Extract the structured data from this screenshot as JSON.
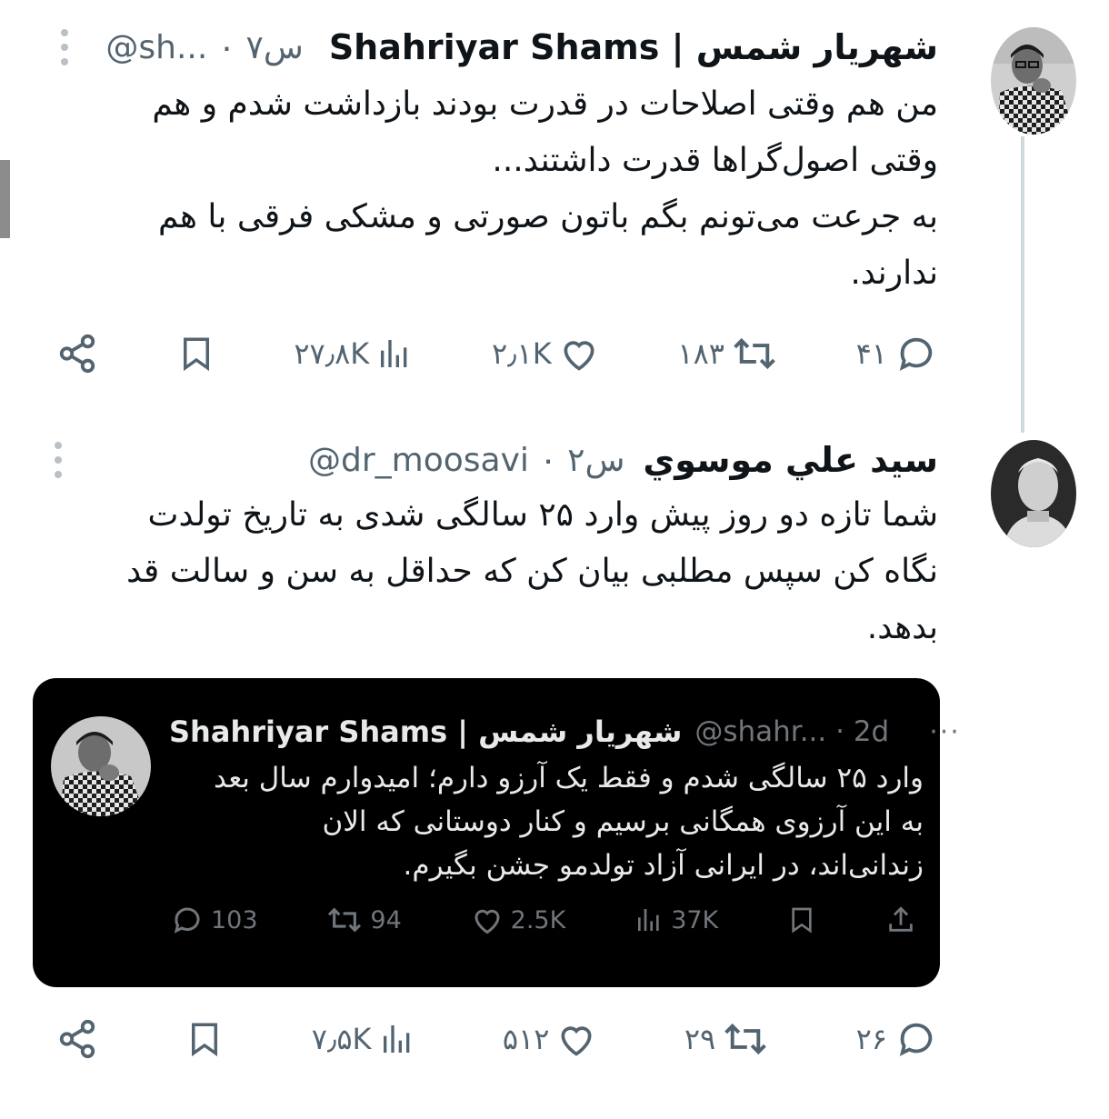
{
  "tweet1": {
    "display_name": "Shahriyar Shams | شهریار شمس",
    "handle_time": "@sh... ۰ ۷س",
    "text": "من هم وقتی اصلاحات در قدرت بودند بازداشت شدم و هم\nوقتی اصول‌گراها قدرت داشتند...\nبه جرعت می‌تونم بگم باتون صورتی و مشکی فرقی با هم\nندارند.",
    "replies": "۴۱",
    "retweets": "۱۸۳",
    "likes": "۲٫۱K",
    "views": "۲۷٫۸K",
    "icons": [
      "share-icon",
      "bookmark-icon",
      "views-icon",
      "like-icon",
      "retweet-icon",
      "reply-icon"
    ]
  },
  "tweet2": {
    "display_name": "سيد علي موسوي",
    "handle_time": "@dr_moosavi ۰ ۲س",
    "text": "شما تازه دو روز پیش وارد ۲۵ سالگی شدی به تاریخ تولدت\nنگاه کن سپس مطلبی بیان کن که حداقل به سن و سالت قد\nبدهد.",
    "replies": "۲۶",
    "retweets": "۲۹",
    "likes": "۵۱۲",
    "views": "۷٫۵K"
  },
  "quote": {
    "display_name": "Shahriyar Shams | شهریار شمس",
    "handle_time": "@shahr... · 2d",
    "text": "وارد ۲۵ سالگی شدم و فقط یک آرزو دارم؛ امیدوارم سال بعد\nبه این آرزوی همگانی برسیم و کنار دوستانی که الان\nزندانی‌اند، در ایرانی آزاد تولدمو جشن بگیرم.",
    "replies": "103",
    "retweets": "94",
    "likes": "2.5K",
    "views": "37K"
  },
  "colors": {
    "text": "#0f1419",
    "secondary": "#536471",
    "thread_line": "#cfd9de",
    "quote_bg": "#000000",
    "quote_text": "#e7e9ea",
    "quote_secondary": "#71767b"
  }
}
